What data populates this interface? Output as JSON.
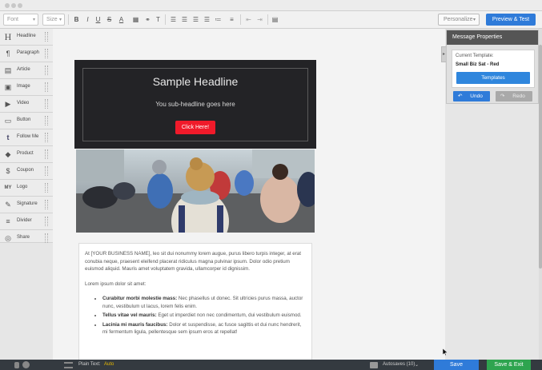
{
  "toolbar": {
    "font_placeholder": "Font",
    "size_placeholder": "Size",
    "bold_label": "B",
    "italic_label": "I",
    "underline_label": "U",
    "strike_label": "S",
    "font_color_label": "A",
    "personalize_label": "Personalize",
    "preview_label": "Preview & Test"
  },
  "sidebar": {
    "items": [
      {
        "label": "Headline",
        "icon": "H"
      },
      {
        "label": "Paragraph",
        "icon": "¶"
      },
      {
        "label": "Article",
        "icon": "▤"
      },
      {
        "label": "Image",
        "icon": "▣"
      },
      {
        "label": "Video",
        "icon": "▶"
      },
      {
        "label": "Button",
        "icon": "▭"
      },
      {
        "label": "Follow Me",
        "icon": "t"
      },
      {
        "label": "Product",
        "icon": "◆"
      },
      {
        "label": "Coupon",
        "icon": "$"
      },
      {
        "label": "Logo",
        "icon": "MY"
      },
      {
        "label": "Signature",
        "icon": "✎"
      },
      {
        "label": "Divider",
        "icon": "≡"
      },
      {
        "label": "Share",
        "icon": "◎"
      }
    ]
  },
  "email": {
    "headline": "Sample Headline",
    "subheadline": "You sub-headline goes here",
    "cta_label": "Click Here!",
    "intro": "At [YOUR BUSINESS NAME], leo sit dui nonummy lorem augue, purus libero turpis integer, at erat conubia neque, praesent eleifend placerat ridiculus magna pulvinar ipsum. Dolor odio pretium euismod aliquid. Mauris amet voluptatem gravida, ullamcorper id dignissim.",
    "list_intro": "Lorem ipsum dolor sit amet:",
    "bullets": [
      {
        "title": "Curabitur morbi molestie mass:",
        "text": " Nec phasellus ut donec. Sit ultricies purus massa, auctor nunc, vestibulum ut lacus, lorem felis enim."
      },
      {
        "title": "Tellus vitae vel mauris:",
        "text": " Eget ut imperdiet non nec condimentum, dui vestibulum euismod."
      },
      {
        "title": "Lacinia mi mauris faucibus:",
        "text": " Dolor et suspendisse, ac fusce sagittis et dui nunc hendrerit, mi fermentum ligula, pellentesque sem ipsum eros at repellat!"
      }
    ]
  },
  "panel": {
    "title": "Message Properties",
    "current_template_label": "Current Template:",
    "current_template_value": "Small Biz Sat - Red",
    "templates_label": "Templates",
    "undo_label": "Undo",
    "redo_label": "Redo"
  },
  "bottombar": {
    "plain_text_label": "Plain Text:",
    "plain_text_value": "Auto",
    "autosaves_label": "Autosaves (10)",
    "save_label": "Save",
    "save_exit_label": "Save & Exit"
  },
  "colors": {
    "accent_blue": "#2f7bd9",
    "cta_red": "#f01a2a",
    "save_exit_green": "#2ea44f",
    "hero_bg": "#232326"
  }
}
